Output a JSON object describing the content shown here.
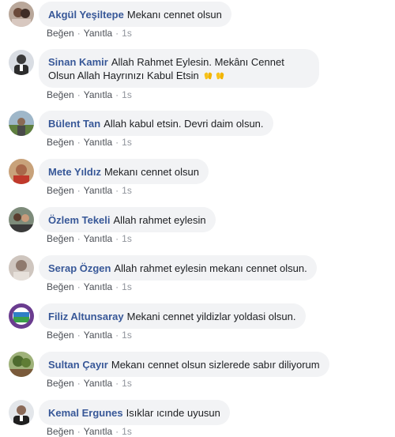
{
  "actions": {
    "like": "Beğen",
    "reply": "Yanıtla",
    "separator": "·"
  },
  "comments": [
    {
      "author": "Akgül Yeşiltepe",
      "text": "Mekanı cennet olsun",
      "time": "1s"
    },
    {
      "author": "Sinan Kamir",
      "text": "Allah Rahmet Eylesin. Mekânı Cennet Olsun Allah Hayrınızı Kabul Etsin",
      "emoji": [
        "hands-icon",
        "hands-icon"
      ],
      "time": "1s"
    },
    {
      "author": "Bülent Tan",
      "text": "Allah kabul etsin. Devri daim olsun.",
      "time": "1s"
    },
    {
      "author": "Mete Yıldız",
      "text": "Mekanı cennet olsun",
      "time": "1s"
    },
    {
      "author": "Özlem Tekeli",
      "text": "Allah rahmet eylesin",
      "time": "1s"
    },
    {
      "author": "Serap Özgen",
      "text": "Allah rahmet eylesin mekanı cennet olsun.",
      "time": "1s"
    },
    {
      "author": "Filiz Altunsaray",
      "text": "Mekani cennet yildizlar yoldasi olsun.",
      "time": "1s"
    },
    {
      "author": "Sultan Çayır",
      "text": "Mekanı cennet olsun sizlerede sabır diliyorum",
      "time": "1s"
    },
    {
      "author": "Kemal Ergunes",
      "text": "Isıklar ıcınde uyusun",
      "time": "1s"
    }
  ]
}
